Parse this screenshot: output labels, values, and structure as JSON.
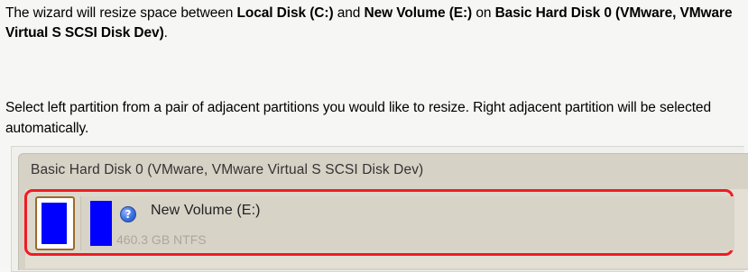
{
  "intro": {
    "prefix": "The wizard will resize space between ",
    "disk_c": "Local Disk (C:)",
    "middle": " and ",
    "disk_e": "New Volume (E:)",
    "on": " on ",
    "disk_name": "Basic Hard Disk 0 (VMware, VMware Virtual S SCSI Disk Dev)",
    "suffix": "."
  },
  "instruction": "Select left partition from a pair of adjacent partitions you would like to resize. Right adjacent partition will be selected automatically.",
  "disk": {
    "title": "Basic Hard Disk 0 (VMware, VMware Virtual S SCSI Disk Dev)",
    "partitions": [
      {
        "id": "c-drive",
        "fill_color": "#0000ff",
        "border_color": "#9d6a2b"
      },
      {
        "id": "e-drive",
        "name": "New Volume (E:)",
        "info": "460.3 GB NTFS",
        "fill_color": "#0000ff",
        "icon": "help-icon"
      }
    ]
  },
  "colors": {
    "selection_border": "#ef1c24",
    "partition_fill": "#0000ff",
    "panel_bg": "#d7d2c6"
  }
}
